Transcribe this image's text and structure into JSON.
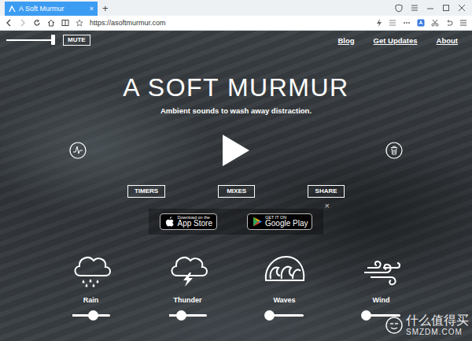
{
  "browser": {
    "tabs": [
      {
        "label": "A Soft Murmur",
        "close": "×",
        "selected": true
      }
    ],
    "new_tab": "+",
    "url": "https://asoftmurmur.com"
  },
  "page": {
    "volume": {
      "level": 0.95
    },
    "mute": "MUTE",
    "nav": [
      {
        "label": "Blog"
      },
      {
        "label": "Get Updates"
      },
      {
        "label": "About"
      }
    ],
    "title": "A SOFT MURMUR",
    "subtitle": "Ambient sounds to wash away distraction.",
    "play": {
      "playing": false
    },
    "buttons": [
      "TIMERS",
      "MIXES",
      "SHARE"
    ],
    "stores": [
      {
        "small": "Download on the",
        "big": "App Store"
      },
      {
        "small": "GET IT ON",
        "big": "Google Play"
      }
    ],
    "dismiss": "×",
    "sounds": [
      {
        "name": "Rain",
        "level": 0.58
      },
      {
        "name": "Thunder",
        "level": 0.34
      },
      {
        "name": "Waves",
        "level": 0.12
      },
      {
        "name": "Wind",
        "level": 0.12
      }
    ]
  },
  "watermark": {
    "text": "什么值得买",
    "sub": "SMZDM.COM"
  }
}
